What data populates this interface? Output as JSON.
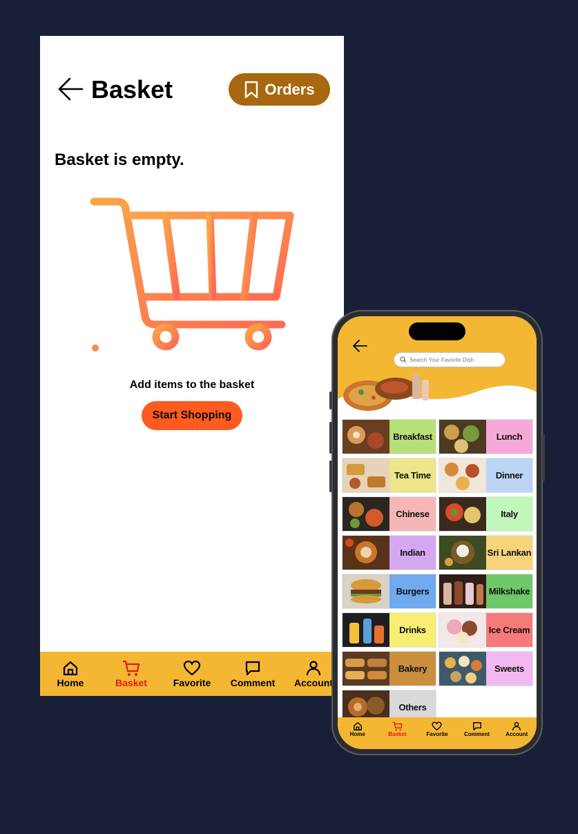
{
  "basket_screen": {
    "title": "Basket",
    "orders_label": "Orders",
    "empty_message": "Basket is empty.",
    "add_items_text": "Add items to the basket",
    "start_shopping_label": "Start Shopping"
  },
  "nav": {
    "items": [
      {
        "label": "Home",
        "icon": "home-icon"
      },
      {
        "label": "Basket",
        "icon": "cart-icon",
        "active": true
      },
      {
        "label": "Favorite",
        "icon": "heart-icon"
      },
      {
        "label": "Comment",
        "icon": "comment-icon"
      },
      {
        "label": "Account",
        "icon": "account-icon"
      }
    ],
    "active_color": "#e8180c"
  },
  "phone": {
    "search_placeholder": "Search Your Favorite Dish",
    "categories": [
      {
        "label": "Breakfast",
        "color": "#b6e07a"
      },
      {
        "label": "Lunch",
        "color": "#f6a8d8"
      },
      {
        "label": "Tea Time",
        "color": "#eee58a"
      },
      {
        "label": "Dinner",
        "color": "#bcd5f5"
      },
      {
        "label": "Chinese",
        "color": "#f7b6b6"
      },
      {
        "label": "Italy",
        "color": "#c2f7bc"
      },
      {
        "label": "Indian",
        "color": "#d3a8f0"
      },
      {
        "label": "Sri Lankan",
        "color": "#f6d47c"
      },
      {
        "label": "Burgers",
        "color": "#6fa9ee"
      },
      {
        "label": "Milkshake",
        "color": "#6fc86a"
      },
      {
        "label": "Drinks",
        "color": "#f7ee73"
      },
      {
        "label": "Ice Cream",
        "color": "#f67a7a"
      },
      {
        "label": "Bakery",
        "color": "#c98e3e"
      },
      {
        "label": "Sweets",
        "color": "#f2b8f2"
      },
      {
        "label": "Others",
        "color": "#d9d9d9"
      }
    ]
  },
  "colors": {
    "accent_yellow": "#f4b733",
    "orders_brown": "#a8680f",
    "start_orange": "#ff5a1f",
    "background": "#1a1f38"
  }
}
